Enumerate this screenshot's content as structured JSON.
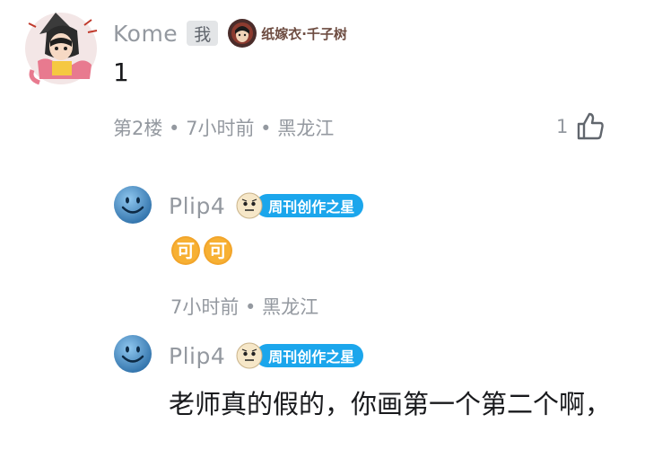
{
  "main_comment": {
    "username": "Kome",
    "me_badge": "我",
    "fan_badge_text": "纸嫁衣·千子树",
    "content": "1",
    "meta": "第2楼 • 7小时前 • 黑龙江",
    "like_count": "1"
  },
  "replies": [
    {
      "username": "Plip4",
      "badge_text": "周刊创作之星",
      "emotes": [
        "可",
        "可"
      ],
      "meta": "7小时前 • 黑龙江"
    },
    {
      "username": "Plip4",
      "badge_text": "周刊创作之星",
      "content": "老师真的假的，你画第一个第二个啊，"
    }
  ],
  "colors": {
    "username": "#9499a0",
    "star_badge": "#1ba6ec",
    "emote": "#f2a52b"
  },
  "icons": {
    "like": "thumbs-up-icon"
  }
}
